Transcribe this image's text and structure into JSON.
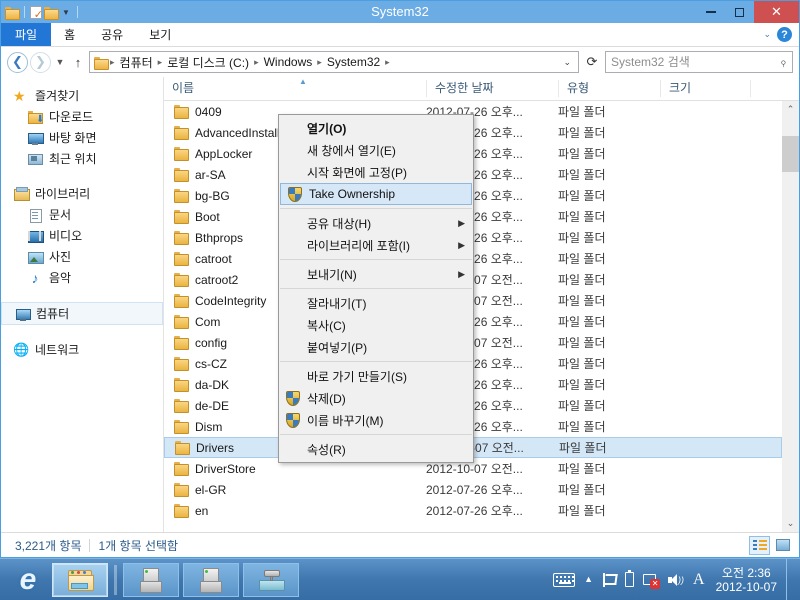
{
  "window": {
    "title": "System32",
    "quick_access": {
      "folder_icon": "folder-icon",
      "properties_icon": "properties-icon",
      "new_folder_icon": "new-folder-icon",
      "customize_icon": "chevron-down-icon"
    },
    "controls": {
      "minimize": "minimize-icon",
      "restore": "restore-icon",
      "close": "close-icon"
    }
  },
  "ribbon": {
    "tabs": [
      {
        "label": "파일",
        "active": true
      },
      {
        "label": "홈",
        "active": false
      },
      {
        "label": "공유",
        "active": false
      },
      {
        "label": "보기",
        "active": false
      }
    ],
    "collapse_icon": "chevron-down-icon",
    "help_label": "?"
  },
  "address": {
    "back_icon": "back-arrow-icon",
    "forward_icon": "forward-arrow-icon",
    "recent_icon": "chevron-down-icon",
    "up_icon": "up-arrow-icon",
    "folder_icon": "folder-icon",
    "breadcrumb": [
      "컴퓨터",
      "로컬 디스크 (C:)",
      "Windows",
      "System32"
    ],
    "dropdown_icon": "chevron-down-icon",
    "refresh_icon": "refresh-icon"
  },
  "search": {
    "placeholder": "System32 검색",
    "value": "",
    "icon": "search-icon"
  },
  "sidebar": {
    "groups": [
      {
        "header": {
          "label": "즐겨찾기",
          "icon": "star-icon"
        },
        "items": [
          {
            "label": "다운로드",
            "icon": "downloads-folder-icon"
          },
          {
            "label": "바탕 화면",
            "icon": "desktop-icon"
          },
          {
            "label": "최근 위치",
            "icon": "recent-places-icon"
          }
        ]
      },
      {
        "header": {
          "label": "라이브러리",
          "icon": "libraries-icon"
        },
        "items": [
          {
            "label": "문서",
            "icon": "documents-icon"
          },
          {
            "label": "비디오",
            "icon": "videos-icon"
          },
          {
            "label": "사진",
            "icon": "pictures-icon"
          },
          {
            "label": "음악",
            "icon": "music-icon"
          }
        ]
      },
      {
        "header": {
          "label": "컴퓨터",
          "icon": "computer-icon",
          "selected": true
        },
        "items": []
      },
      {
        "header": {
          "label": "네트워크",
          "icon": "network-icon"
        },
        "items": []
      }
    ]
  },
  "filelist": {
    "columns": [
      {
        "label": "이름",
        "sorted": true
      },
      {
        "label": "수정한 날짜"
      },
      {
        "label": "유형"
      },
      {
        "label": "크기"
      }
    ],
    "sort_indicator": "sort-ascending-icon",
    "rows": [
      {
        "name": "0409",
        "date": "2012-07-26 오후...",
        "type": "파일 폴더",
        "size": "",
        "selected": false
      },
      {
        "name": "AdvancedInstallers",
        "date": "2012-07-26 오후...",
        "type": "파일 폴더",
        "size": "",
        "selected": false
      },
      {
        "name": "AppLocker",
        "date": "2012-07-26 오후...",
        "type": "파일 폴더",
        "size": "",
        "selected": false
      },
      {
        "name": "ar-SA",
        "date": "2012-07-26 오후...",
        "type": "파일 폴더",
        "size": "",
        "selected": false
      },
      {
        "name": "bg-BG",
        "date": "2012-07-26 오후...",
        "type": "파일 폴더",
        "size": "",
        "selected": false
      },
      {
        "name": "Boot",
        "date": "2012-07-26 오후...",
        "type": "파일 폴더",
        "size": "",
        "selected": false
      },
      {
        "name": "Bthprops",
        "date": "2012-07-26 오후...",
        "type": "파일 폴더",
        "size": "",
        "selected": false
      },
      {
        "name": "catroot",
        "date": "2012-07-26 오후...",
        "type": "파일 폴더",
        "size": "",
        "selected": false
      },
      {
        "name": "catroot2",
        "date": "2012-10-07 오전...",
        "type": "파일 폴더",
        "size": "",
        "selected": false
      },
      {
        "name": "CodeIntegrity",
        "date": "2012-10-07 오전...",
        "type": "파일 폴더",
        "size": "",
        "selected": false
      },
      {
        "name": "Com",
        "date": "2012-07-26 오후...",
        "type": "파일 폴더",
        "size": "",
        "selected": false
      },
      {
        "name": "config",
        "date": "2012-10-07 오전...",
        "type": "파일 폴더",
        "size": "",
        "selected": false
      },
      {
        "name": "cs-CZ",
        "date": "2012-07-26 오후...",
        "type": "파일 폴더",
        "size": "",
        "selected": false
      },
      {
        "name": "da-DK",
        "date": "2012-07-26 오후...",
        "type": "파일 폴더",
        "size": "",
        "selected": false
      },
      {
        "name": "de-DE",
        "date": "2012-07-26 오후...",
        "type": "파일 폴더",
        "size": "",
        "selected": false
      },
      {
        "name": "Dism",
        "date": "2012-07-26 오후...",
        "type": "파일 폴더",
        "size": "",
        "selected": false
      },
      {
        "name": "Drivers",
        "date": "2012-10-07 오전...",
        "type": "파일 폴더",
        "size": "",
        "selected": true
      },
      {
        "name": "DriverStore",
        "date": "2012-10-07 오전...",
        "type": "파일 폴더",
        "size": "",
        "selected": false
      },
      {
        "name": "el-GR",
        "date": "2012-07-26 오후...",
        "type": "파일 폴더",
        "size": "",
        "selected": false
      },
      {
        "name": "en",
        "date": "2012-07-26 오후...",
        "type": "파일 폴더",
        "size": "",
        "selected": false
      }
    ],
    "scrollbar": {
      "up_icon": "chevron-up-icon",
      "down_icon": "chevron-down-icon"
    }
  },
  "context_menu": {
    "items": [
      {
        "label": "열기(O)",
        "bold": true,
        "icon": null,
        "submenu": false,
        "highlighted": false
      },
      {
        "label": "새 창에서 열기(E)",
        "bold": false,
        "icon": null,
        "submenu": false,
        "highlighted": false
      },
      {
        "label": "시작 화면에 고정(P)",
        "bold": false,
        "icon": null,
        "submenu": false,
        "highlighted": false
      },
      {
        "label": "Take Ownership",
        "bold": false,
        "icon": "shield-icon",
        "submenu": false,
        "highlighted": true
      },
      {
        "separator": true
      },
      {
        "label": "공유 대상(H)",
        "bold": false,
        "icon": null,
        "submenu": true,
        "highlighted": false
      },
      {
        "label": "라이브러리에 포함(I)",
        "bold": false,
        "icon": null,
        "submenu": true,
        "highlighted": false
      },
      {
        "separator": true
      },
      {
        "label": "보내기(N)",
        "bold": false,
        "icon": null,
        "submenu": true,
        "highlighted": false
      },
      {
        "separator": true
      },
      {
        "label": "잘라내기(T)",
        "bold": false,
        "icon": null,
        "submenu": false,
        "highlighted": false
      },
      {
        "label": "복사(C)",
        "bold": false,
        "icon": null,
        "submenu": false,
        "highlighted": false
      },
      {
        "label": "붙여넣기(P)",
        "bold": false,
        "icon": null,
        "submenu": false,
        "highlighted": false
      },
      {
        "separator": true
      },
      {
        "label": "바로 가기 만들기(S)",
        "bold": false,
        "icon": null,
        "submenu": false,
        "highlighted": false
      },
      {
        "label": "삭제(D)",
        "bold": false,
        "icon": "shield-icon",
        "submenu": false,
        "highlighted": false
      },
      {
        "label": "이름 바꾸기(M)",
        "bold": false,
        "icon": "shield-icon",
        "submenu": false,
        "highlighted": false
      },
      {
        "separator": true
      },
      {
        "label": "속성(R)",
        "bold": false,
        "icon": null,
        "submenu": false,
        "highlighted": false
      }
    ]
  },
  "statusbar": {
    "item_count": "3,221개 항목",
    "selection": "1개 항목 선택함",
    "views": [
      {
        "name": "details-view-button",
        "active": true
      },
      {
        "name": "large-icons-view-button",
        "active": false
      }
    ]
  },
  "taskbar": {
    "buttons": [
      {
        "name": "internet-explorer",
        "icon": "internet-explorer-icon",
        "active": false
      },
      {
        "name": "file-explorer",
        "icon": "file-explorer-icon",
        "active": true
      },
      {
        "name": "virtual-machine-1",
        "icon": "computer-tower-icon",
        "active": false
      },
      {
        "name": "virtual-machine-2",
        "icon": "computer-tower-icon",
        "active": false
      },
      {
        "name": "toolbox",
        "icon": "toolbox-icon",
        "active": false
      }
    ],
    "tray": [
      {
        "name": "touch-keyboard-icon"
      },
      {
        "name": "show-hidden-icons-icon",
        "glyph": "▲"
      },
      {
        "name": "action-center-flag-icon"
      },
      {
        "name": "battery-icon"
      },
      {
        "name": "network-disconnected-icon"
      },
      {
        "name": "volume-icon"
      },
      {
        "name": "ime-mode-icon",
        "glyph": "A"
      }
    ],
    "clock": {
      "time": "오전 2:36",
      "date": "2012-10-07"
    }
  },
  "colors": {
    "accent": "#2277d6",
    "titlebar": "#6cace4",
    "close": "#cf5050",
    "selection": "#d4e7f7",
    "taskbar": "#3f77ae"
  }
}
